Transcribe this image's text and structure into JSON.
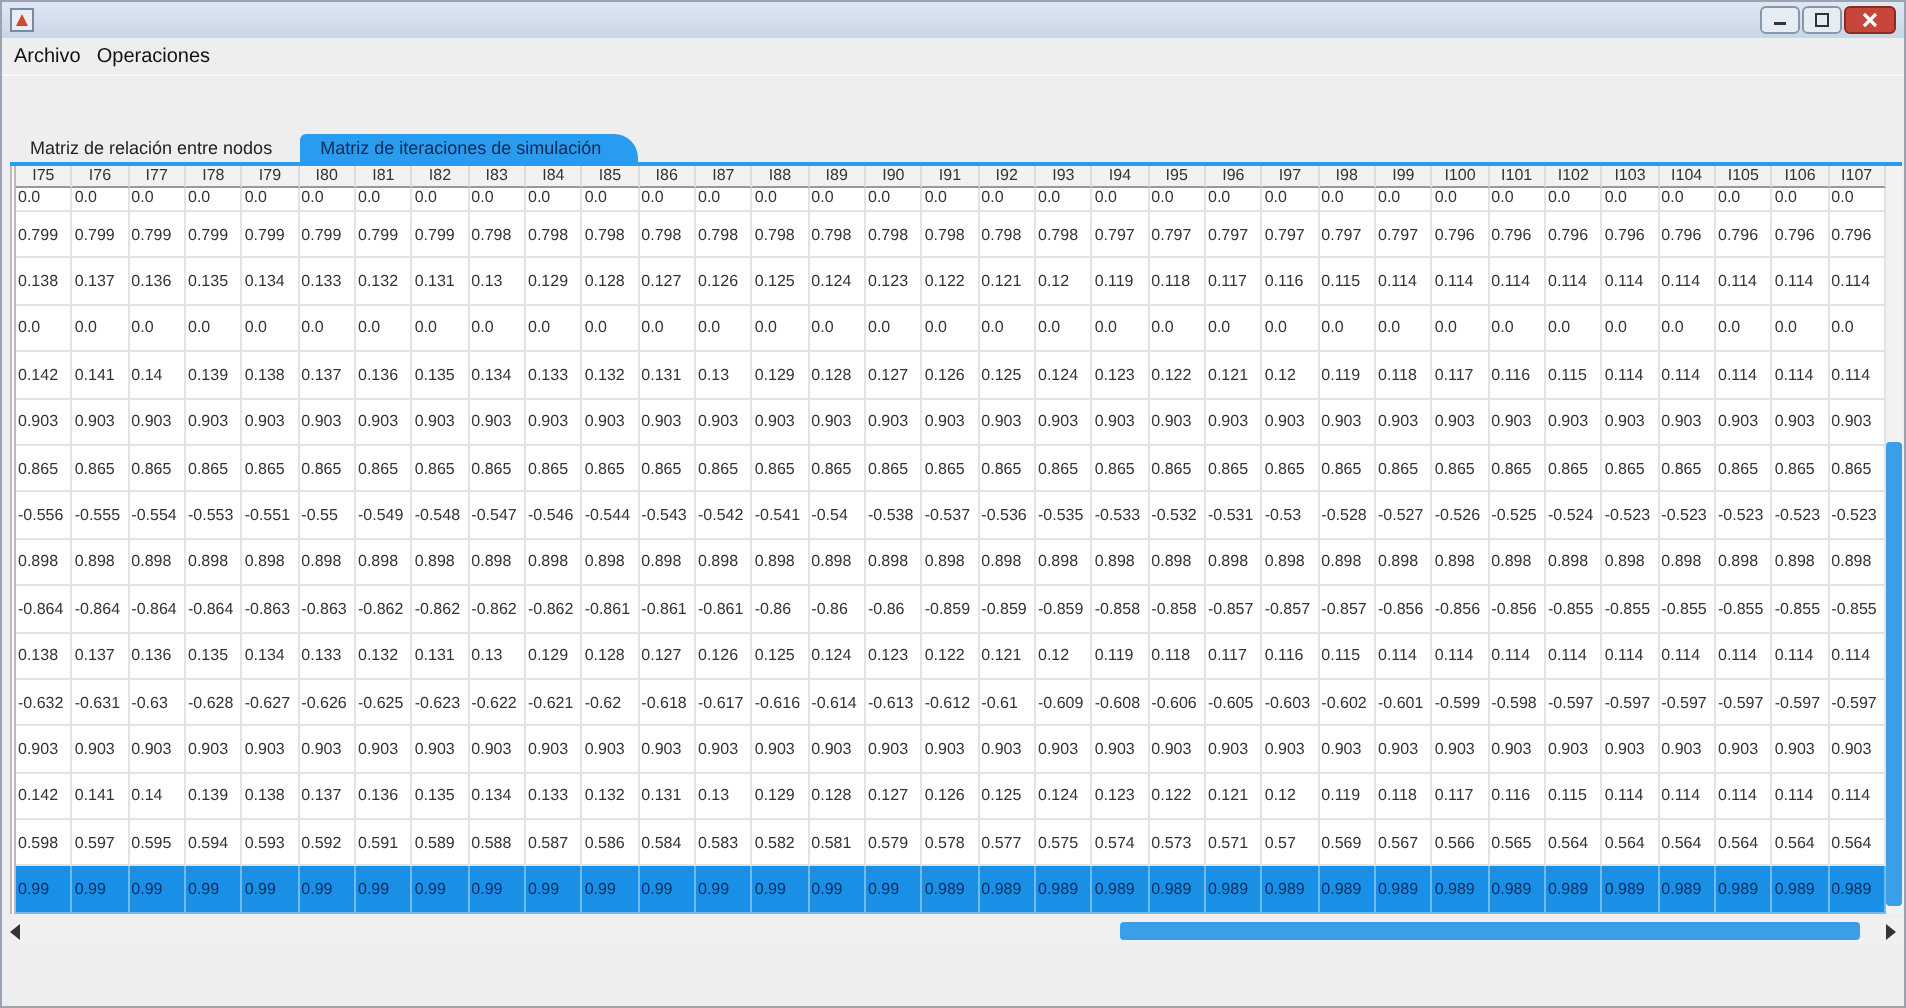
{
  "menu": [
    "Archivo",
    "Operaciones"
  ],
  "tabs": [
    {
      "label": "Matriz de relación entre nodos",
      "selected": false
    },
    {
      "label": "Matriz de iteraciones de simulación",
      "selected": true
    }
  ],
  "table": {
    "columns": [
      "I75",
      "I76",
      "I77",
      "I78",
      "I79",
      "I80",
      "I81",
      "I82",
      "I83",
      "I84",
      "I85",
      "I86",
      "I87",
      "I88",
      "I89",
      "I90",
      "I91",
      "I92",
      "I93",
      "I94",
      "I95",
      "I96",
      "I97",
      "I98",
      "I99",
      "I100",
      "I101",
      "I102",
      "I103",
      "I104",
      "I105",
      "I106",
      "I107"
    ],
    "rows": [
      {
        "selected": false,
        "cells": [
          "0.0",
          "0.0",
          "0.0",
          "0.0",
          "0.0",
          "0.0",
          "0.0",
          "0.0",
          "0.0",
          "0.0",
          "0.0",
          "0.0",
          "0.0",
          "0.0",
          "0.0",
          "0.0",
          "0.0",
          "0.0",
          "0.0",
          "0.0",
          "0.0",
          "0.0",
          "0.0",
          "0.0",
          "0.0",
          "0.0",
          "0.0",
          "0.0",
          "0.0",
          "0.0",
          "0.0",
          "0.0",
          "0.0"
        ]
      },
      {
        "selected": false,
        "cells": [
          "0.799",
          "0.799",
          "0.799",
          "0.799",
          "0.799",
          "0.799",
          "0.799",
          "0.799",
          "0.798",
          "0.798",
          "0.798",
          "0.798",
          "0.798",
          "0.798",
          "0.798",
          "0.798",
          "0.798",
          "0.798",
          "0.798",
          "0.797",
          "0.797",
          "0.797",
          "0.797",
          "0.797",
          "0.797",
          "0.796",
          "0.796",
          "0.796",
          "0.796",
          "0.796",
          "0.796",
          "0.796",
          "0.796"
        ]
      },
      {
        "selected": false,
        "cells": [
          "0.138",
          "0.137",
          "0.136",
          "0.135",
          "0.134",
          "0.133",
          "0.132",
          "0.131",
          "0.13",
          "0.129",
          "0.128",
          "0.127",
          "0.126",
          "0.125",
          "0.124",
          "0.123",
          "0.122",
          "0.121",
          "0.12",
          "0.119",
          "0.118",
          "0.117",
          "0.116",
          "0.115",
          "0.114",
          "0.114",
          "0.114",
          "0.114",
          "0.114",
          "0.114",
          "0.114",
          "0.114",
          "0.114"
        ]
      },
      {
        "selected": false,
        "cells": [
          "0.0",
          "0.0",
          "0.0",
          "0.0",
          "0.0",
          "0.0",
          "0.0",
          "0.0",
          "0.0",
          "0.0",
          "0.0",
          "0.0",
          "0.0",
          "0.0",
          "0.0",
          "0.0",
          "0.0",
          "0.0",
          "0.0",
          "0.0",
          "0.0",
          "0.0",
          "0.0",
          "0.0",
          "0.0",
          "0.0",
          "0.0",
          "0.0",
          "0.0",
          "0.0",
          "0.0",
          "0.0",
          "0.0"
        ]
      },
      {
        "selected": false,
        "cells": [
          "0.142",
          "0.141",
          "0.14",
          "0.139",
          "0.138",
          "0.137",
          "0.136",
          "0.135",
          "0.134",
          "0.133",
          "0.132",
          "0.131",
          "0.13",
          "0.129",
          "0.128",
          "0.127",
          "0.126",
          "0.125",
          "0.124",
          "0.123",
          "0.122",
          "0.121",
          "0.12",
          "0.119",
          "0.118",
          "0.117",
          "0.116",
          "0.115",
          "0.114",
          "0.114",
          "0.114",
          "0.114",
          "0.114"
        ]
      },
      {
        "selected": false,
        "cells": [
          "0.903",
          "0.903",
          "0.903",
          "0.903",
          "0.903",
          "0.903",
          "0.903",
          "0.903",
          "0.903",
          "0.903",
          "0.903",
          "0.903",
          "0.903",
          "0.903",
          "0.903",
          "0.903",
          "0.903",
          "0.903",
          "0.903",
          "0.903",
          "0.903",
          "0.903",
          "0.903",
          "0.903",
          "0.903",
          "0.903",
          "0.903",
          "0.903",
          "0.903",
          "0.903",
          "0.903",
          "0.903",
          "0.903"
        ]
      },
      {
        "selected": false,
        "cells": [
          "0.865",
          "0.865",
          "0.865",
          "0.865",
          "0.865",
          "0.865",
          "0.865",
          "0.865",
          "0.865",
          "0.865",
          "0.865",
          "0.865",
          "0.865",
          "0.865",
          "0.865",
          "0.865",
          "0.865",
          "0.865",
          "0.865",
          "0.865",
          "0.865",
          "0.865",
          "0.865",
          "0.865",
          "0.865",
          "0.865",
          "0.865",
          "0.865",
          "0.865",
          "0.865",
          "0.865",
          "0.865",
          "0.865"
        ]
      },
      {
        "selected": false,
        "cells": [
          "-0.556",
          "-0.555",
          "-0.554",
          "-0.553",
          "-0.551",
          "-0.55",
          "-0.549",
          "-0.548",
          "-0.547",
          "-0.546",
          "-0.544",
          "-0.543",
          "-0.542",
          "-0.541",
          "-0.54",
          "-0.538",
          "-0.537",
          "-0.536",
          "-0.535",
          "-0.533",
          "-0.532",
          "-0.531",
          "-0.53",
          "-0.528",
          "-0.527",
          "-0.526",
          "-0.525",
          "-0.524",
          "-0.523",
          "-0.523",
          "-0.523",
          "-0.523",
          "-0.523"
        ]
      },
      {
        "selected": false,
        "cells": [
          "0.898",
          "0.898",
          "0.898",
          "0.898",
          "0.898",
          "0.898",
          "0.898",
          "0.898",
          "0.898",
          "0.898",
          "0.898",
          "0.898",
          "0.898",
          "0.898",
          "0.898",
          "0.898",
          "0.898",
          "0.898",
          "0.898",
          "0.898",
          "0.898",
          "0.898",
          "0.898",
          "0.898",
          "0.898",
          "0.898",
          "0.898",
          "0.898",
          "0.898",
          "0.898",
          "0.898",
          "0.898",
          "0.898"
        ]
      },
      {
        "selected": false,
        "cells": [
          "-0.864",
          "-0.864",
          "-0.864",
          "-0.864",
          "-0.863",
          "-0.863",
          "-0.862",
          "-0.862",
          "-0.862",
          "-0.862",
          "-0.861",
          "-0.861",
          "-0.861",
          "-0.86",
          "-0.86",
          "-0.86",
          "-0.859",
          "-0.859",
          "-0.859",
          "-0.858",
          "-0.858",
          "-0.857",
          "-0.857",
          "-0.857",
          "-0.856",
          "-0.856",
          "-0.856",
          "-0.855",
          "-0.855",
          "-0.855",
          "-0.855",
          "-0.855",
          "-0.855"
        ]
      },
      {
        "selected": false,
        "cells": [
          "0.138",
          "0.137",
          "0.136",
          "0.135",
          "0.134",
          "0.133",
          "0.132",
          "0.131",
          "0.13",
          "0.129",
          "0.128",
          "0.127",
          "0.126",
          "0.125",
          "0.124",
          "0.123",
          "0.122",
          "0.121",
          "0.12",
          "0.119",
          "0.118",
          "0.117",
          "0.116",
          "0.115",
          "0.114",
          "0.114",
          "0.114",
          "0.114",
          "0.114",
          "0.114",
          "0.114",
          "0.114",
          "0.114"
        ]
      },
      {
        "selected": false,
        "cells": [
          "-0.632",
          "-0.631",
          "-0.63",
          "-0.628",
          "-0.627",
          "-0.626",
          "-0.625",
          "-0.623",
          "-0.622",
          "-0.621",
          "-0.62",
          "-0.618",
          "-0.617",
          "-0.616",
          "-0.614",
          "-0.613",
          "-0.612",
          "-0.61",
          "-0.609",
          "-0.608",
          "-0.606",
          "-0.605",
          "-0.603",
          "-0.602",
          "-0.601",
          "-0.599",
          "-0.598",
          "-0.597",
          "-0.597",
          "-0.597",
          "-0.597",
          "-0.597",
          "-0.597"
        ]
      },
      {
        "selected": false,
        "cells": [
          "0.903",
          "0.903",
          "0.903",
          "0.903",
          "0.903",
          "0.903",
          "0.903",
          "0.903",
          "0.903",
          "0.903",
          "0.903",
          "0.903",
          "0.903",
          "0.903",
          "0.903",
          "0.903",
          "0.903",
          "0.903",
          "0.903",
          "0.903",
          "0.903",
          "0.903",
          "0.903",
          "0.903",
          "0.903",
          "0.903",
          "0.903",
          "0.903",
          "0.903",
          "0.903",
          "0.903",
          "0.903",
          "0.903"
        ]
      },
      {
        "selected": false,
        "cells": [
          "0.142",
          "0.141",
          "0.14",
          "0.139",
          "0.138",
          "0.137",
          "0.136",
          "0.135",
          "0.134",
          "0.133",
          "0.132",
          "0.131",
          "0.13",
          "0.129",
          "0.128",
          "0.127",
          "0.126",
          "0.125",
          "0.124",
          "0.123",
          "0.122",
          "0.121",
          "0.12",
          "0.119",
          "0.118",
          "0.117",
          "0.116",
          "0.115",
          "0.114",
          "0.114",
          "0.114",
          "0.114",
          "0.114"
        ]
      },
      {
        "selected": false,
        "cells": [
          "0.598",
          "0.597",
          "0.595",
          "0.594",
          "0.593",
          "0.592",
          "0.591",
          "0.589",
          "0.588",
          "0.587",
          "0.586",
          "0.584",
          "0.583",
          "0.582",
          "0.581",
          "0.579",
          "0.578",
          "0.577",
          "0.575",
          "0.574",
          "0.573",
          "0.571",
          "0.57",
          "0.569",
          "0.567",
          "0.566",
          "0.565",
          "0.564",
          "0.564",
          "0.564",
          "0.564",
          "0.564",
          "0.564"
        ]
      },
      {
        "selected": true,
        "cells": [
          "0.99",
          "0.99",
          "0.99",
          "0.99",
          "0.99",
          "0.99",
          "0.99",
          "0.99",
          "0.99",
          "0.99",
          "0.99",
          "0.99",
          "0.99",
          "0.99",
          "0.99",
          "0.99",
          "0.989",
          "0.989",
          "0.989",
          "0.989",
          "0.989",
          "0.989",
          "0.989",
          "0.989",
          "0.989",
          "0.989",
          "0.989",
          "0.989",
          "0.989",
          "0.989",
          "0.989",
          "0.989",
          "0.989"
        ]
      }
    ]
  }
}
